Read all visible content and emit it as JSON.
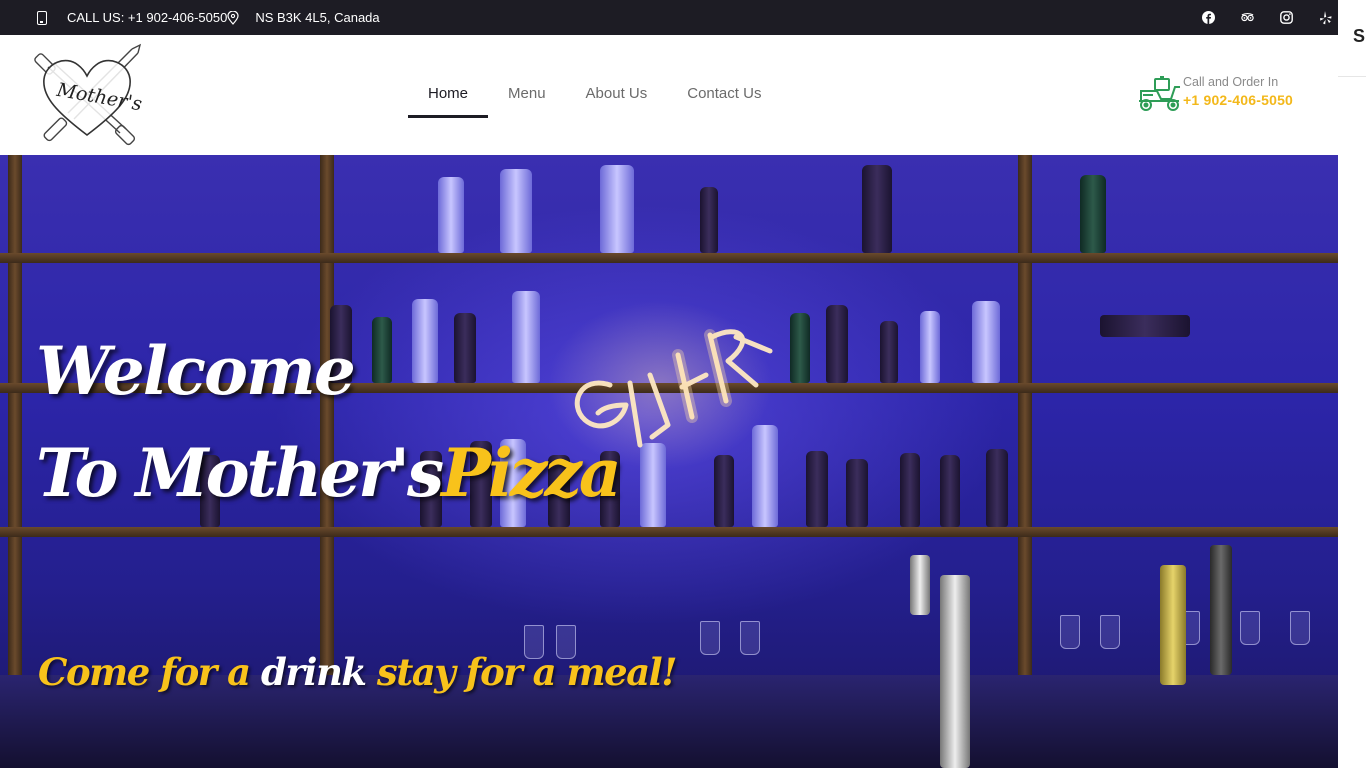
{
  "topbar": {
    "call_text": "CALL US: +1 902-406-5050",
    "address": "NS B3K 4L5, Canada",
    "socials": [
      "facebook-icon",
      "tripadvisor-icon",
      "instagram-icon",
      "yelp-icon"
    ]
  },
  "side": {
    "letter": "S"
  },
  "nav": {
    "items": [
      {
        "label": "Home",
        "active": true
      },
      {
        "label": "Menu",
        "active": false
      },
      {
        "label": "About Us",
        "active": false
      },
      {
        "label": "Contact Us",
        "active": false
      }
    ]
  },
  "order": {
    "label": "Call and Order In",
    "phone": "+1 902-406-5050"
  },
  "hero": {
    "line1": "Welcome",
    "line2_white": "To Mother's",
    "line2_yellow": "Pizza",
    "tag_part1": "Come for a",
    "tag_part2": "drink",
    "tag_part3": "stay for a meal!"
  },
  "colors": {
    "topbar_bg": "#1d1c24",
    "accent_yellow": "#f8c21b",
    "order_green": "#2e9d57",
    "hero_blue": "#2c25a8"
  }
}
